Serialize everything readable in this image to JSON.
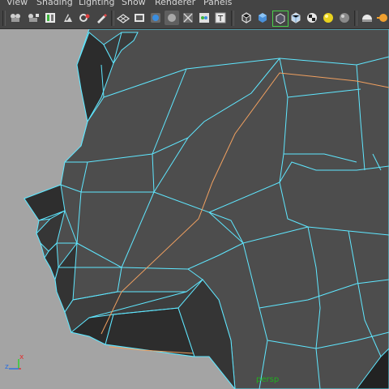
{
  "menu": {
    "items": [
      {
        "label": "View"
      },
      {
        "label": "Shading"
      },
      {
        "label": "Lighting"
      },
      {
        "label": "Show"
      },
      {
        "label": "Renderer"
      },
      {
        "label": "Panels"
      }
    ]
  },
  "toolbar": {
    "icons": [
      "select-camera-icon",
      "camera-attributes-icon",
      "bookmark-icon",
      "image-plane-icon",
      "grease-pencil-icon",
      "grid-icon",
      "film-gate-icon",
      "resolution-gate-icon",
      "gate-mask-icon",
      "field-chart-icon",
      "safe-action-icon",
      "safe-title-icon",
      "wireframe-icon",
      "smooth-shade-icon",
      "wireframe-on-shaded-icon",
      "xray-icon",
      "use-default-material-icon",
      "textured-icon",
      "use-all-lights-icon",
      "shadows-icon",
      "ambient-occlusion-icon",
      "motion-blur-icon"
    ]
  },
  "viewport": {
    "camera_name": "persp",
    "axis": {
      "x": "x",
      "y": "",
      "z": "z"
    },
    "colors": {
      "background": "#a4a4a4",
      "wireframe": "#5fe7ff",
      "selected_edge": "#f0a060",
      "camera_label": "#1fb11f"
    }
  }
}
